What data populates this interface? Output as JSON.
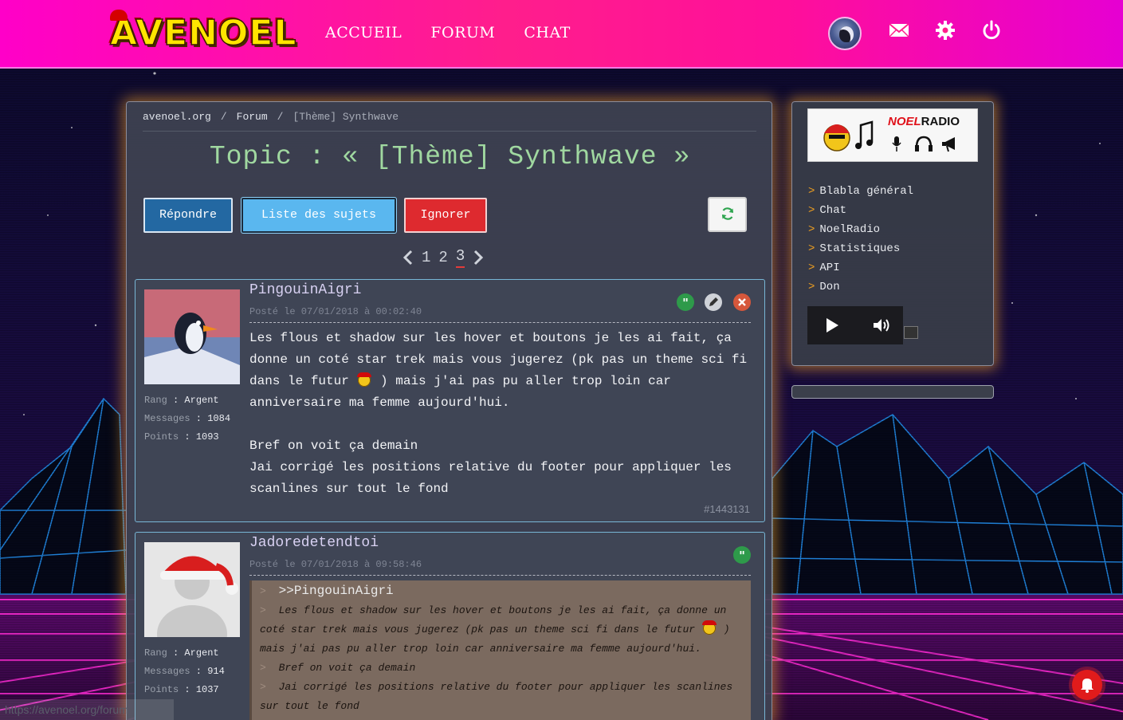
{
  "header": {
    "logo_text": "AVENOEL",
    "nav": [
      "ACCUEIL",
      "FORUM",
      "CHAT"
    ],
    "icons": [
      "user-avatar",
      "envelope-icon",
      "gear-icon",
      "power-icon"
    ]
  },
  "breadcrumb": [
    "avenoel.org",
    "Forum",
    "[Thème] Synthwave"
  ],
  "topic_title": "Topic : « [Thème] Synthwave »",
  "buttons": {
    "reply": "Répondre",
    "list": "Liste des sujets",
    "ignore": "Ignorer",
    "refresh_icon": "refresh-icon"
  },
  "pagination": {
    "pages": [
      "1",
      "2",
      "3"
    ],
    "current": "3"
  },
  "posts": [
    {
      "author": "PingouinAigri",
      "date": "Posté le 07/01/2018 à 00:02:40",
      "rank_label": "Rang",
      "rank": "Argent",
      "messages_label": "Messages",
      "messages": "1084",
      "points_label": "Points",
      "points": "1093",
      "body": [
        "Les flous et shadow sur les hover et boutons je les ai fait, ça donne un coté star trek mais vous jugerez (pk pas un theme sci fi dans le futur",
        ") mais j'ai pas pu aller trop loin car anniversaire ma femme aujourd'hui.",
        "Bref on voit ça demain",
        "Jai corrigé les positions relative du footer pour appliquer les scanlines sur tout le fond"
      ],
      "id": "#1443131"
    },
    {
      "author": "Jadoredetendtoi",
      "date": "Posté le 07/01/2018 à 09:58:46",
      "rank_label": "Rang",
      "rank": "Argent",
      "messages_label": "Messages",
      "messages": "914",
      "points_label": "Points",
      "points": "1037",
      "quote_author": ">>PingouinAigri",
      "quote": [
        "Les flous et shadow sur les hover et boutons je les ai fait, ça donne un coté star trek mais vous jugerez (pk pas un theme sci fi dans le futur",
        ")",
        "mais j'ai pas pu aller trop loin car anniversaire ma femme aujourd'hui.",
        "Bref on voit ça demain",
        "Jai corrigé les positions relative du footer pour appliquer les scanlines sur tout le fond"
      ]
    }
  ],
  "sidebar": {
    "radio_title_a": "NOEL",
    "radio_title_b": "RADIO",
    "links": [
      "Blabla général",
      "Chat",
      "NoelRadio",
      "Statistiques",
      "API",
      "Don"
    ]
  },
  "status_url": "https://avenoel.org/forum",
  "colors": {
    "header_pink": "#ff1e8c",
    "glow_orange": "#ffaa28",
    "title_green": "#a0d8a0",
    "reply_blue": "#2368a2",
    "list_cyan": "#5ab7ef",
    "ignore_red": "#de2a2f"
  }
}
